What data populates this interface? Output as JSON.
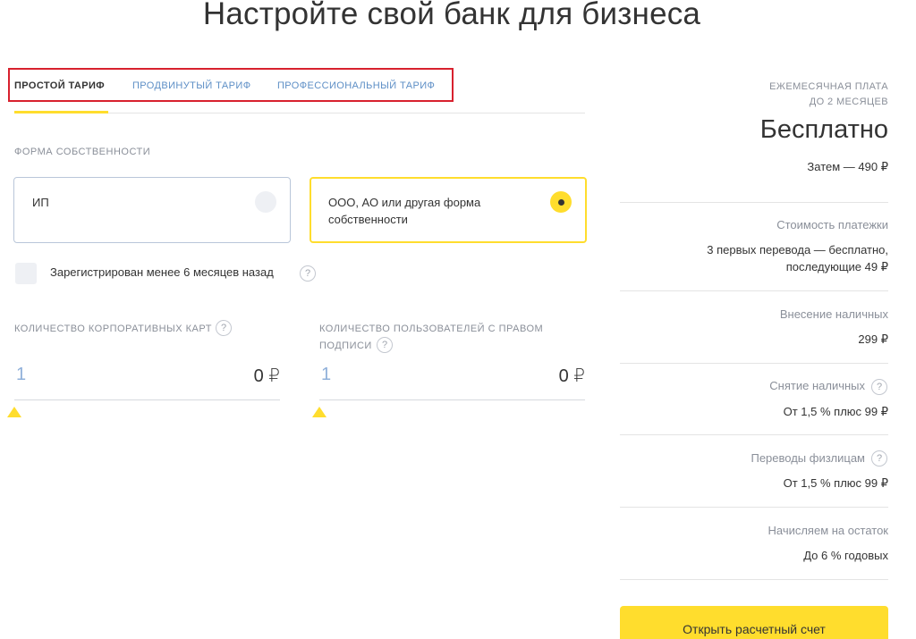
{
  "page_title": "Настройте свой банк для бизнеса",
  "tabs": [
    {
      "label": "ПРОСТОЙ ТАРИФ",
      "active": true
    },
    {
      "label": "ПРОДВИНУТЫЙ ТАРИФ",
      "active": false
    },
    {
      "label": "ПРОФЕССИОНАЛЬНЫЙ ТАРИФ",
      "active": false
    }
  ],
  "ownership": {
    "label": "ФОРМА СОБСТВЕННОСТИ",
    "options": [
      {
        "label": "ИП",
        "selected": false
      },
      {
        "label": "ООО, АО или другая форма собственности",
        "selected": true
      }
    ]
  },
  "recent_registration": {
    "label": "Зарегистрирован менее 6 месяцев назад",
    "checked": false
  },
  "help_symbol": "?",
  "cards": {
    "label": "КОЛИЧЕСТВО КОРПОРАТИВНЫХ КАРТ",
    "quantity": "1",
    "price": "0 ₽"
  },
  "signers": {
    "label_line1": "КОЛИЧЕСТВО ПОЛЬЗОВАТЕЛЕЙ С ПРАВОМ",
    "label_line2": "ПОДПИСИ",
    "quantity": "1",
    "price": "0 ₽"
  },
  "sidebar": {
    "monthly_fee_line1": "ЕЖЕМЕСЯЧНАЯ ПЛАТА",
    "monthly_fee_line2": "ДО 2 МЕСЯЦЕВ",
    "monthly_fee_value": "Бесплатно",
    "monthly_fee_then": "Затем — 490 ₽",
    "payments_caption": "Стоимость платежки",
    "payments_value_line1": "3 первых перевода — бесплатно,",
    "payments_value_line2": "последующие 49 ₽",
    "cash_in_caption": "Внесение наличных",
    "cash_in_value": "299 ₽",
    "cash_out_caption": "Снятие наличных",
    "cash_out_value": "От 1,5 % плюс 99 ₽",
    "transfers_caption": "Переводы физлицам",
    "transfers_value": "От 1,5 % плюс 99 ₽",
    "interest_caption": "Начисляем на остаток",
    "interest_value": "До 6 % годовых"
  },
  "open_account_button": "Открыть расчетный счет",
  "colors": {
    "accent": "#ffdd2d",
    "link": "#5e8fc6",
    "highlight_border": "#d8212e"
  }
}
